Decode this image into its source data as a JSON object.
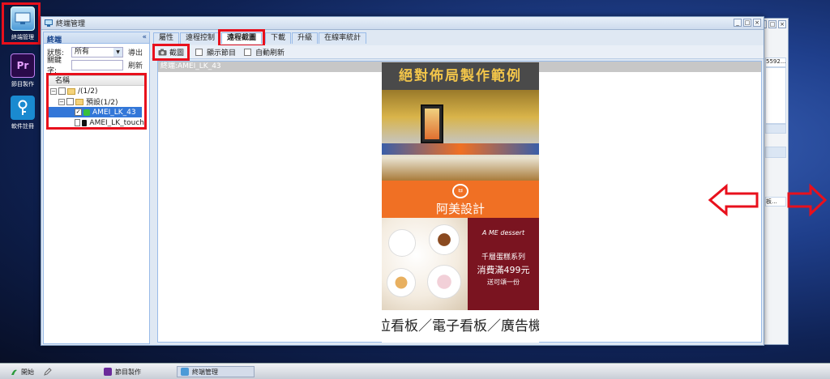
{
  "desktop": {
    "icons": [
      {
        "label": "終端管理",
        "icon": "monitor-icon"
      },
      {
        "label": "節目製作",
        "icon": "premiere-icon",
        "glyph": "Pr"
      },
      {
        "label": "軟件註冊",
        "icon": "key-icon"
      }
    ]
  },
  "window": {
    "title": "終端管理",
    "controls": [
      "_",
      "□",
      "×"
    ]
  },
  "left_panel": {
    "title": "終端",
    "status_label": "狀態:",
    "status_value": "所有",
    "export_button": "導出",
    "keyword_label": "關鍵字:",
    "keyword_value": "",
    "refresh_button": "刷新",
    "column_header": "名稱",
    "tree": {
      "root": "/(1/2)",
      "group": "預設(1/2)",
      "items": [
        "AMEI_LK_43",
        "AMEI_LK_touch"
      ]
    }
  },
  "tabs": [
    "屬性",
    "遠程控制",
    "遠程截圖",
    "下載",
    "升級",
    "在線率統計"
  ],
  "active_tab": "遠程截圖",
  "toolbar": {
    "screenshot_button": "截圖",
    "show_program_label": "顯示節目",
    "auto_refresh_label": "自動刷新"
  },
  "content": {
    "terminal_label": "終端:AMEI_LK_43"
  },
  "poster": {
    "headline": "絕對佈局製作範例",
    "brand": "阿美設計",
    "brand_logo": "ㅂ",
    "dessert_brand": "A ME dessert",
    "promo_line1": "千層蛋糕系列",
    "promo_line2": "消費滿499元",
    "promo_line3": "送可頌一份",
    "footer": "位看板／電子看板／廣告機"
  },
  "back_window": {
    "partial_text_1": "5592...",
    "partial_text_2": "板..."
  },
  "taskbar": {
    "start": "開始",
    "tasks": [
      "節目製作",
      "終端管理"
    ]
  },
  "colors": {
    "annotation_red": "#e8101c",
    "poster_orange": "#f07024",
    "poster_red": "#7a1420",
    "headline_gold": "#f3c64a"
  }
}
